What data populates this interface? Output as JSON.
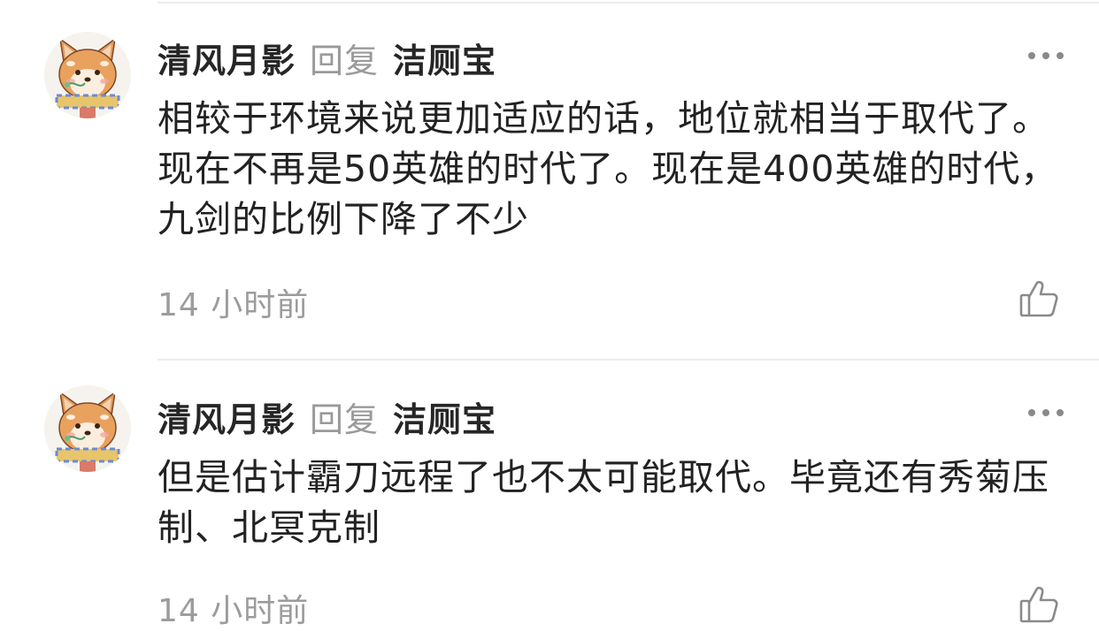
{
  "comments": [
    {
      "author": "清风月影",
      "reply_label": "回复",
      "reply_target": "洁厕宝",
      "text": "相较于环境来说更加适应的话，地位就相当于取代了。现在不再是50英雄的时代了。现在是400英雄的时代，九剑的比例下降了不少",
      "time": "14 小时前",
      "avatar_icon": "shiba-dog-avatar",
      "more_icon": "more-dots-icon",
      "like_icon": "thumbs-up-icon"
    },
    {
      "author": "清风月影",
      "reply_label": "回复",
      "reply_target": "洁厕宝",
      "text": "但是估计霸刀远程了也不太可能取代。毕竟还有秀菊压制、北冥克制",
      "time": "14 小时前",
      "avatar_icon": "shiba-dog-avatar",
      "more_icon": "more-dots-icon",
      "like_icon": "thumbs-up-icon"
    }
  ]
}
